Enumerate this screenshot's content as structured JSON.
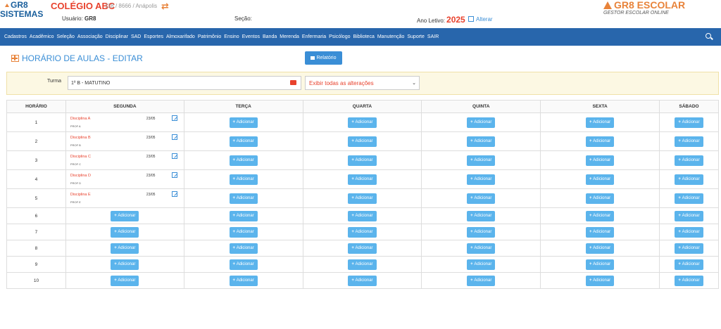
{
  "header": {
    "logo_line1": "GR8",
    "logo_line2": "SISTEMAS",
    "school_name": "COLÉGIO ABC",
    "school_info": "118 / 8666 / Anápolis",
    "user_label": "Usuário:",
    "user_value": "GR8",
    "secao_label": "Seção:",
    "ano_label": "Ano Letivo:",
    "ano_value": "2025",
    "alterar": "Alterar",
    "brand": "GR8 ESCOLAR",
    "brand_sub": "GESTOR ESCOLAR ONLINE"
  },
  "nav": {
    "items": [
      "Cadastros",
      "Acadêmico",
      "Seleção",
      "Associação",
      "Disciplinar",
      "SAD",
      "Esportes",
      "Almoxarifado",
      "Patrimônio",
      "Ensino",
      "Eventos",
      "Banda",
      "Merenda",
      "Enfermaria",
      "Psicólogo",
      "Biblioteca",
      "Manutenção",
      "Suporte",
      "SAIR"
    ]
  },
  "page": {
    "title": "HORÁRIO DE AULAS - EDITAR",
    "relatorio": "Relatório",
    "turma_label": "Turma",
    "turma_value": "1º B - MATUTINO",
    "exibir": "Exibir todas as alterações"
  },
  "table": {
    "headers": [
      "HORÁRIO",
      "SEGUNDA",
      "TERÇA",
      "QUARTA",
      "QUINTA",
      "SEXTA",
      "SÁBADO"
    ],
    "add_label": "Adicionar",
    "rows": [
      {
        "num": "1",
        "disc": "Disciplina A",
        "prof": "PROF A",
        "date": "23/05"
      },
      {
        "num": "2",
        "disc": "Disciplina B",
        "prof": "PROF B",
        "date": "23/05"
      },
      {
        "num": "3",
        "disc": "Disciplina C",
        "prof": "PROF C",
        "date": "23/05"
      },
      {
        "num": "4",
        "disc": "Disciplina D",
        "prof": "PROF D",
        "date": "23/05"
      },
      {
        "num": "5",
        "disc": "Disciplina E",
        "prof": "PROF E",
        "date": "23/05"
      },
      {
        "num": "6"
      },
      {
        "num": "7"
      },
      {
        "num": "8"
      },
      {
        "num": "9"
      },
      {
        "num": "10"
      }
    ]
  },
  "colors": {
    "nav": "#2866ac",
    "accent": "#3a8ed6",
    "red": "#e8412c",
    "orange": "#e8833a",
    "add_btn": "#5bb4ec"
  }
}
